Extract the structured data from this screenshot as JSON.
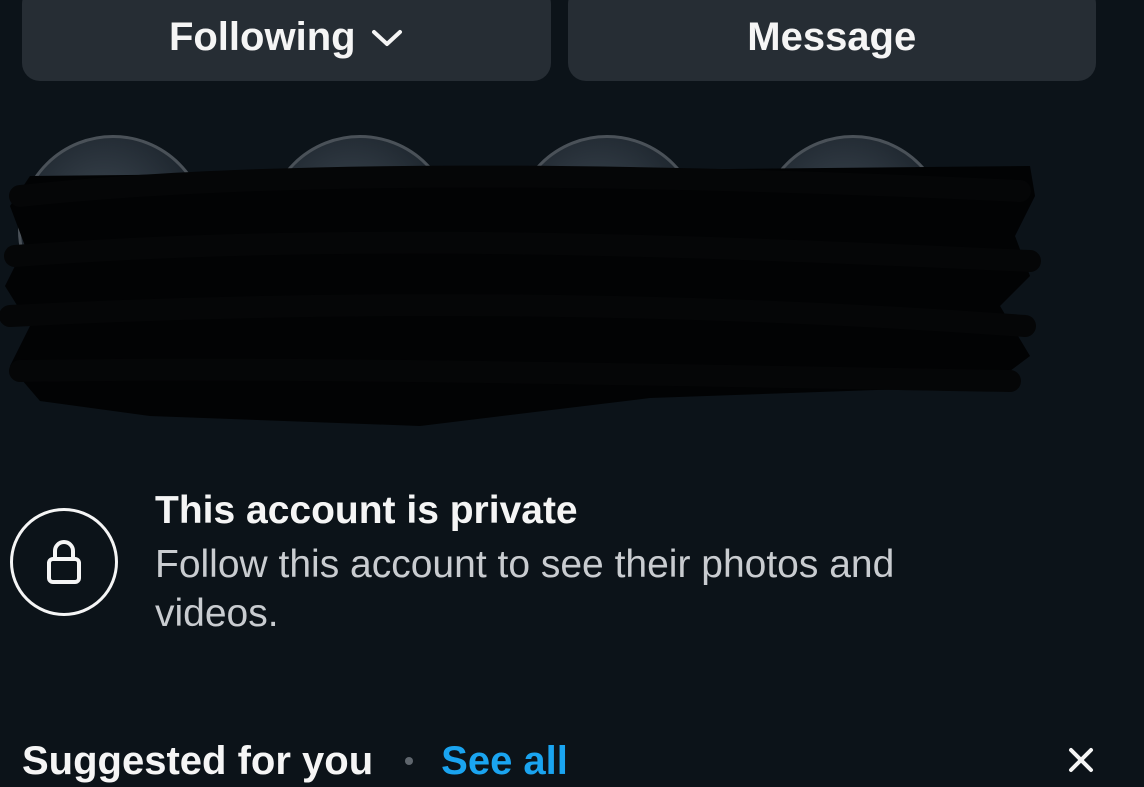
{
  "actions": {
    "following_label": "Following",
    "following_icon": "chevron-down-icon",
    "message_label": "Message"
  },
  "private": {
    "icon": "lock-icon",
    "title": "This account is private",
    "description": "Follow this account to see their photos and videos."
  },
  "suggested": {
    "title": "Suggested for you",
    "see_all_label": "See all",
    "dismiss_icon": "close-icon"
  },
  "colors": {
    "background": "#0c1319",
    "button_bg": "#262d34",
    "link": "#1aa4f0",
    "secondary_text": "#c9ccd0"
  }
}
